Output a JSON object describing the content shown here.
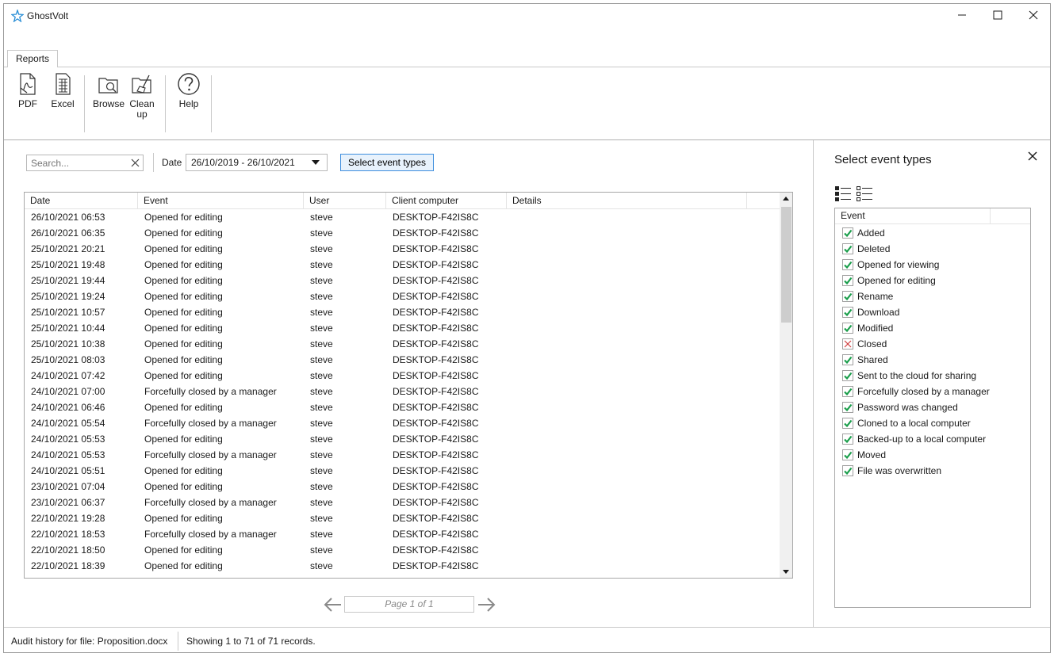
{
  "app": {
    "title": "GhostVolt",
    "logo_icon": "ghostvolt-star-icon"
  },
  "window_controls": {
    "minimize_icon": "minimize-icon",
    "maximize_icon": "maximize-icon",
    "close_icon": "close-icon"
  },
  "ribbon": {
    "tab": "Reports",
    "buttons": [
      {
        "label": "PDF",
        "icon": "pdf-file-icon"
      },
      {
        "label": "Excel",
        "icon": "spreadsheet-icon"
      },
      {
        "label": "Browse",
        "icon": "folder-search-icon"
      },
      {
        "label": "Clean up",
        "icon": "cleanup-icon"
      },
      {
        "label": "Help",
        "icon": "help-icon"
      }
    ]
  },
  "filters": {
    "search_placeholder": "Search...",
    "date_label": "Date",
    "date_range": "26/10/2019 - 26/10/2021",
    "event_types_button": "Select event types"
  },
  "grid": {
    "columns": [
      "Date",
      "Event",
      "User",
      "Client computer",
      "Details"
    ],
    "rows": [
      [
        "26/10/2021 06:53",
        "Opened for editing",
        "steve",
        "DESKTOP-F42IS8C",
        ""
      ],
      [
        "26/10/2021 06:35",
        "Opened for editing",
        "steve",
        "DESKTOP-F42IS8C",
        ""
      ],
      [
        "25/10/2021 20:21",
        "Opened for editing",
        "steve",
        "DESKTOP-F42IS8C",
        ""
      ],
      [
        "25/10/2021 19:48",
        "Opened for editing",
        "steve",
        "DESKTOP-F42IS8C",
        ""
      ],
      [
        "25/10/2021 19:44",
        "Opened for editing",
        "steve",
        "DESKTOP-F42IS8C",
        ""
      ],
      [
        "25/10/2021 19:24",
        "Opened for editing",
        "steve",
        "DESKTOP-F42IS8C",
        ""
      ],
      [
        "25/10/2021 10:57",
        "Opened for editing",
        "steve",
        "DESKTOP-F42IS8C",
        ""
      ],
      [
        "25/10/2021 10:44",
        "Opened for editing",
        "steve",
        "DESKTOP-F42IS8C",
        ""
      ],
      [
        "25/10/2021 10:38",
        "Opened for editing",
        "steve",
        "DESKTOP-F42IS8C",
        ""
      ],
      [
        "25/10/2021 08:03",
        "Opened for editing",
        "steve",
        "DESKTOP-F42IS8C",
        ""
      ],
      [
        "24/10/2021 07:42",
        "Opened for editing",
        "steve",
        "DESKTOP-F42IS8C",
        ""
      ],
      [
        "24/10/2021 07:00",
        "Forcefully closed by a manager",
        "steve",
        "DESKTOP-F42IS8C",
        ""
      ],
      [
        "24/10/2021 06:46",
        "Opened for editing",
        "steve",
        "DESKTOP-F42IS8C",
        ""
      ],
      [
        "24/10/2021 05:54",
        "Forcefully closed by a manager",
        "steve",
        "DESKTOP-F42IS8C",
        ""
      ],
      [
        "24/10/2021 05:53",
        "Opened for editing",
        "steve",
        "DESKTOP-F42IS8C",
        ""
      ],
      [
        "24/10/2021 05:53",
        "Forcefully closed by a manager",
        "steve",
        "DESKTOP-F42IS8C",
        ""
      ],
      [
        "24/10/2021 05:51",
        "Opened for editing",
        "steve",
        "DESKTOP-F42IS8C",
        ""
      ],
      [
        "23/10/2021 07:04",
        "Opened for editing",
        "steve",
        "DESKTOP-F42IS8C",
        ""
      ],
      [
        "23/10/2021 06:37",
        "Forcefully closed by a manager",
        "steve",
        "DESKTOP-F42IS8C",
        ""
      ],
      [
        "22/10/2021 19:28",
        "Opened for editing",
        "steve",
        "DESKTOP-F42IS8C",
        ""
      ],
      [
        "22/10/2021 18:53",
        "Forcefully closed by a manager",
        "steve",
        "DESKTOP-F42IS8C",
        ""
      ],
      [
        "22/10/2021 18:50",
        "Opened for editing",
        "steve",
        "DESKTOP-F42IS8C",
        ""
      ],
      [
        "22/10/2021 18:39",
        "Opened for editing",
        "steve",
        "DESKTOP-F42IS8C",
        ""
      ]
    ]
  },
  "pager": {
    "text": "Page 1 of 1",
    "prev_icon": "arrow-left-icon",
    "next_icon": "arrow-right-icon"
  },
  "event_panel": {
    "title": "Select event types",
    "select_all_icon": "select-all-icon",
    "select_none_icon": "select-none-icon",
    "column_header": "Event",
    "items": [
      {
        "label": "Added",
        "checked": true
      },
      {
        "label": "Deleted",
        "checked": true
      },
      {
        "label": "Opened for viewing",
        "checked": true
      },
      {
        "label": "Opened for editing",
        "checked": true
      },
      {
        "label": "Rename",
        "checked": true
      },
      {
        "label": "Download",
        "checked": true
      },
      {
        "label": "Modified",
        "checked": true
      },
      {
        "label": "Closed",
        "checked": false
      },
      {
        "label": "Shared",
        "checked": true
      },
      {
        "label": "Sent to the cloud for sharing",
        "checked": true
      },
      {
        "label": "Forcefully closed by a manager",
        "checked": true
      },
      {
        "label": "Password was changed",
        "checked": true
      },
      {
        "label": "Cloned to a local computer",
        "checked": true
      },
      {
        "label": "Backed-up to a local computer",
        "checked": true
      },
      {
        "label": "Moved",
        "checked": true
      },
      {
        "label": "File was overwritten",
        "checked": true
      }
    ]
  },
  "status": {
    "file": "Audit history for file: Proposition.docx",
    "records": "Showing 1 to 71 of 71 records."
  },
  "colors": {
    "check_green": "#1a9e4b",
    "uncheck_red": "#d04040",
    "accent_blue": "#3e8ede"
  }
}
